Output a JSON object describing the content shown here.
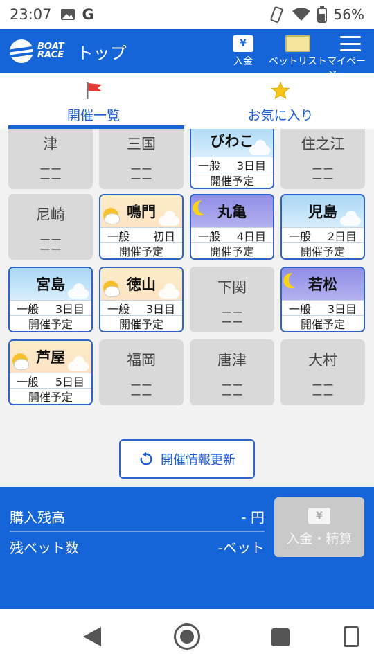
{
  "status_bar": {
    "time": "23:07",
    "g_label": "G",
    "battery": "56%"
  },
  "header": {
    "logo_line1": "BOAT",
    "logo_line2": "RACE",
    "title": "トップ",
    "deposit_label": "入金",
    "betlist_label": "ベットリスト",
    "mypage_label": "マイページ",
    "yen_symbol": "¥"
  },
  "tabs": [
    {
      "label": "開催一覧",
      "icon": "flag-icon",
      "active": true
    },
    {
      "label": "お気に入り",
      "icon": "star-icon",
      "active": false
    }
  ],
  "venues": [
    {
      "name": "津",
      "status": "off",
      "dash1": "ーー",
      "dash2": "ーー"
    },
    {
      "name": "三国",
      "status": "off",
      "dash1": "ーー",
      "dash2": "ーー"
    },
    {
      "name": "びわこ",
      "status": "day",
      "grade": "一般",
      "day": "3日目",
      "schedule": "開催予定"
    },
    {
      "name": "住之江",
      "status": "off",
      "dash1": "ーー",
      "dash2": "ーー"
    },
    {
      "name": "尼崎",
      "status": "off",
      "dash1": "ーー",
      "dash2": "ーー"
    },
    {
      "name": "鳴門",
      "status": "morning",
      "grade": "一般",
      "day": "初日",
      "schedule": "開催予定"
    },
    {
      "name": "丸亀",
      "status": "night",
      "grade": "一般",
      "day": "4日目",
      "schedule": "開催予定"
    },
    {
      "name": "児島",
      "status": "day",
      "grade": "一般",
      "day": "2日目",
      "schedule": "開催予定"
    },
    {
      "name": "宮島",
      "status": "day",
      "grade": "一般",
      "day": "3日目",
      "schedule": "開催予定"
    },
    {
      "name": "徳山",
      "status": "morning",
      "grade": "一般",
      "day": "3日目",
      "schedule": "開催予定"
    },
    {
      "name": "下関",
      "status": "off",
      "dash1": "ーー",
      "dash2": "ーー"
    },
    {
      "name": "若松",
      "status": "night",
      "grade": "一般",
      "day": "3日目",
      "schedule": "開催予定"
    },
    {
      "name": "芦屋",
      "status": "morning",
      "grade": "一般",
      "day": "5日目",
      "schedule": "開催予定"
    },
    {
      "name": "福岡",
      "status": "off",
      "dash1": "ーー",
      "dash2": "ーー"
    },
    {
      "name": "唐津",
      "status": "off",
      "dash1": "ーー",
      "dash2": "ーー"
    },
    {
      "name": "大村",
      "status": "off",
      "dash1": "ーー",
      "dash2": "ーー"
    }
  ],
  "refresh_label": "開催情報更新",
  "balance": {
    "purchase_label": "購入残高",
    "purchase_value": "- 円",
    "bets_label": "残ベット数",
    "bets_value": "-ベット",
    "deposit_button": "入金・精算"
  },
  "colors": {
    "brand": "#1565d8",
    "tile_border": "#2f63c9",
    "disabled": "#c9c9c9"
  }
}
